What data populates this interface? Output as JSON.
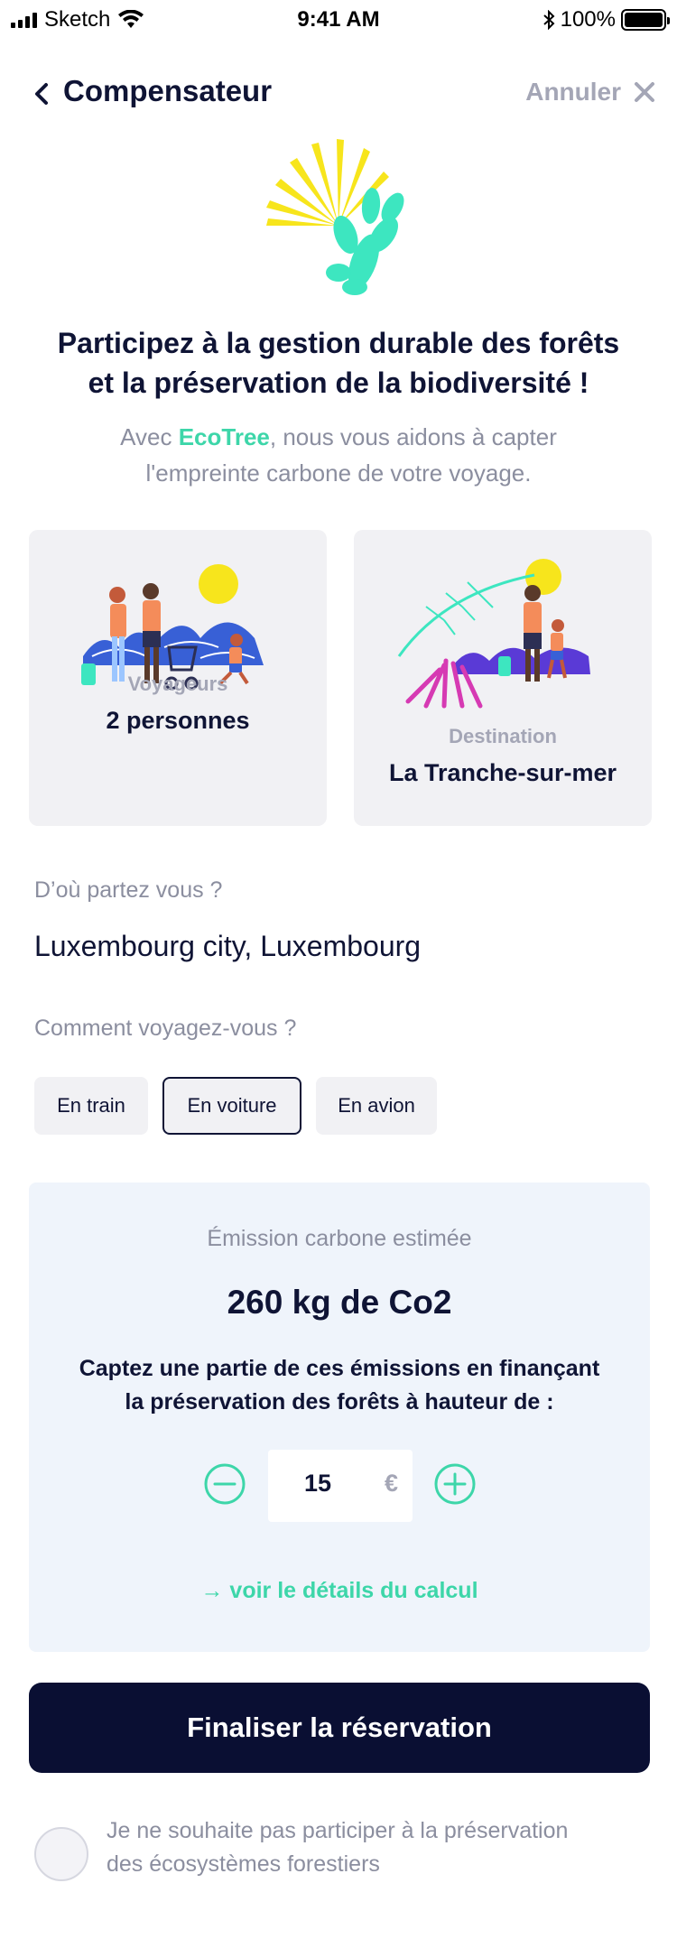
{
  "status_bar": {
    "carrier": "Sketch",
    "time": "9:41 AM",
    "battery": "100%"
  },
  "nav": {
    "title": "Compensateur",
    "cancel_label": "Annuler"
  },
  "intro": {
    "headline_line1": "Participez à la gestion durable des forêts",
    "headline_line2": "et la préservation de la biodiversité !",
    "sub_prefix": "Avec ",
    "brand": "EcoTree",
    "sub_suffix": ", nous vous aidons à capter",
    "sub_line2": "l'empreinte carbone de votre voyage."
  },
  "cards": {
    "travelers": {
      "label": "Voyageurs",
      "value": "2 personnes"
    },
    "destination": {
      "label": "Destination",
      "value": "La Tranche-sur-mer"
    }
  },
  "origin": {
    "question": "D’où partez vous ?",
    "answer": "Luxembourg city, Luxembourg"
  },
  "transport": {
    "question": "Comment voyagez-vous ?",
    "options": [
      "En train",
      "En voiture",
      "En avion"
    ],
    "selected": "En voiture"
  },
  "estimate": {
    "label": "Émission carbone estimée",
    "value": "260 kg de Co2",
    "text_line1": "Captez une partie de ces émissions en finançant",
    "text_line2": "la préservation des forêts à hauteur de :",
    "amount": "15",
    "currency": "€",
    "detail_link": "→ voir le détails du calcul"
  },
  "cta": {
    "label": "Finaliser la réservation"
  },
  "optout": {
    "line1": "Je ne souhaite pas participer à la préservation",
    "line2": "des écosystèmes forestiers"
  },
  "colors": {
    "navy": "#0f1435",
    "button_navy": "#0a0f33",
    "accent_green": "#3dd6a9",
    "muted_text": "#8b8e9f",
    "card_bg": "#f1f1f4",
    "estimate_bg": "#eff4fb",
    "sun_yellow": "#f7e51c"
  }
}
